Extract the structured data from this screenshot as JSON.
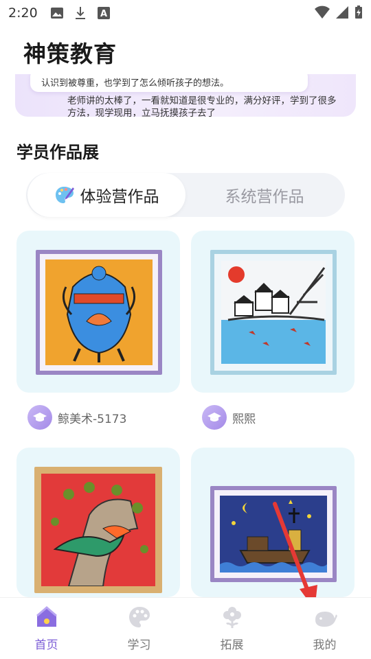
{
  "status_bar": {
    "time": "2:20",
    "icons": [
      "image-icon",
      "download-icon",
      "font-icon"
    ],
    "right_icons": [
      "wifi-icon",
      "signal-icon",
      "battery-charging-icon"
    ]
  },
  "app": {
    "title": "神策教育"
  },
  "review": {
    "bubble_text": "认识到被尊重，也学到了怎么倾听孩子的想法。",
    "text": "老师讲的太棒了，一看就知道是很专业的，满分好评，学到了很多方法，现学现用，立马抚摸孩子去了"
  },
  "gallery": {
    "title": "学员作品展",
    "tabs": [
      {
        "label": "体验营作品",
        "active": true
      },
      {
        "label": "系统营作品",
        "active": false
      }
    ],
    "works": [
      {
        "owner": "鲸美术-5173",
        "frame_color": "#9a86c4",
        "art": "blue-incense-burner"
      },
      {
        "owner": "熙熙",
        "frame_color": "#a9d2e2",
        "art": "village-by-water"
      },
      {
        "owner": "",
        "frame_color": "#d9b071",
        "art": "bird-on-tree"
      },
      {
        "owner": "",
        "frame_color": "#9a86c4",
        "art": "night-boat"
      }
    ]
  },
  "bottom_nav": [
    {
      "label": "首页",
      "icon": "home-icon",
      "active": true
    },
    {
      "label": "学习",
      "icon": "palette-icon",
      "active": false
    },
    {
      "label": "拓展",
      "icon": "flower-icon",
      "active": false
    },
    {
      "label": "我的",
      "icon": "whale-icon",
      "active": false
    }
  ],
  "colors": {
    "accent": "#7b5cd6",
    "annotation_arrow": "#e53935"
  }
}
